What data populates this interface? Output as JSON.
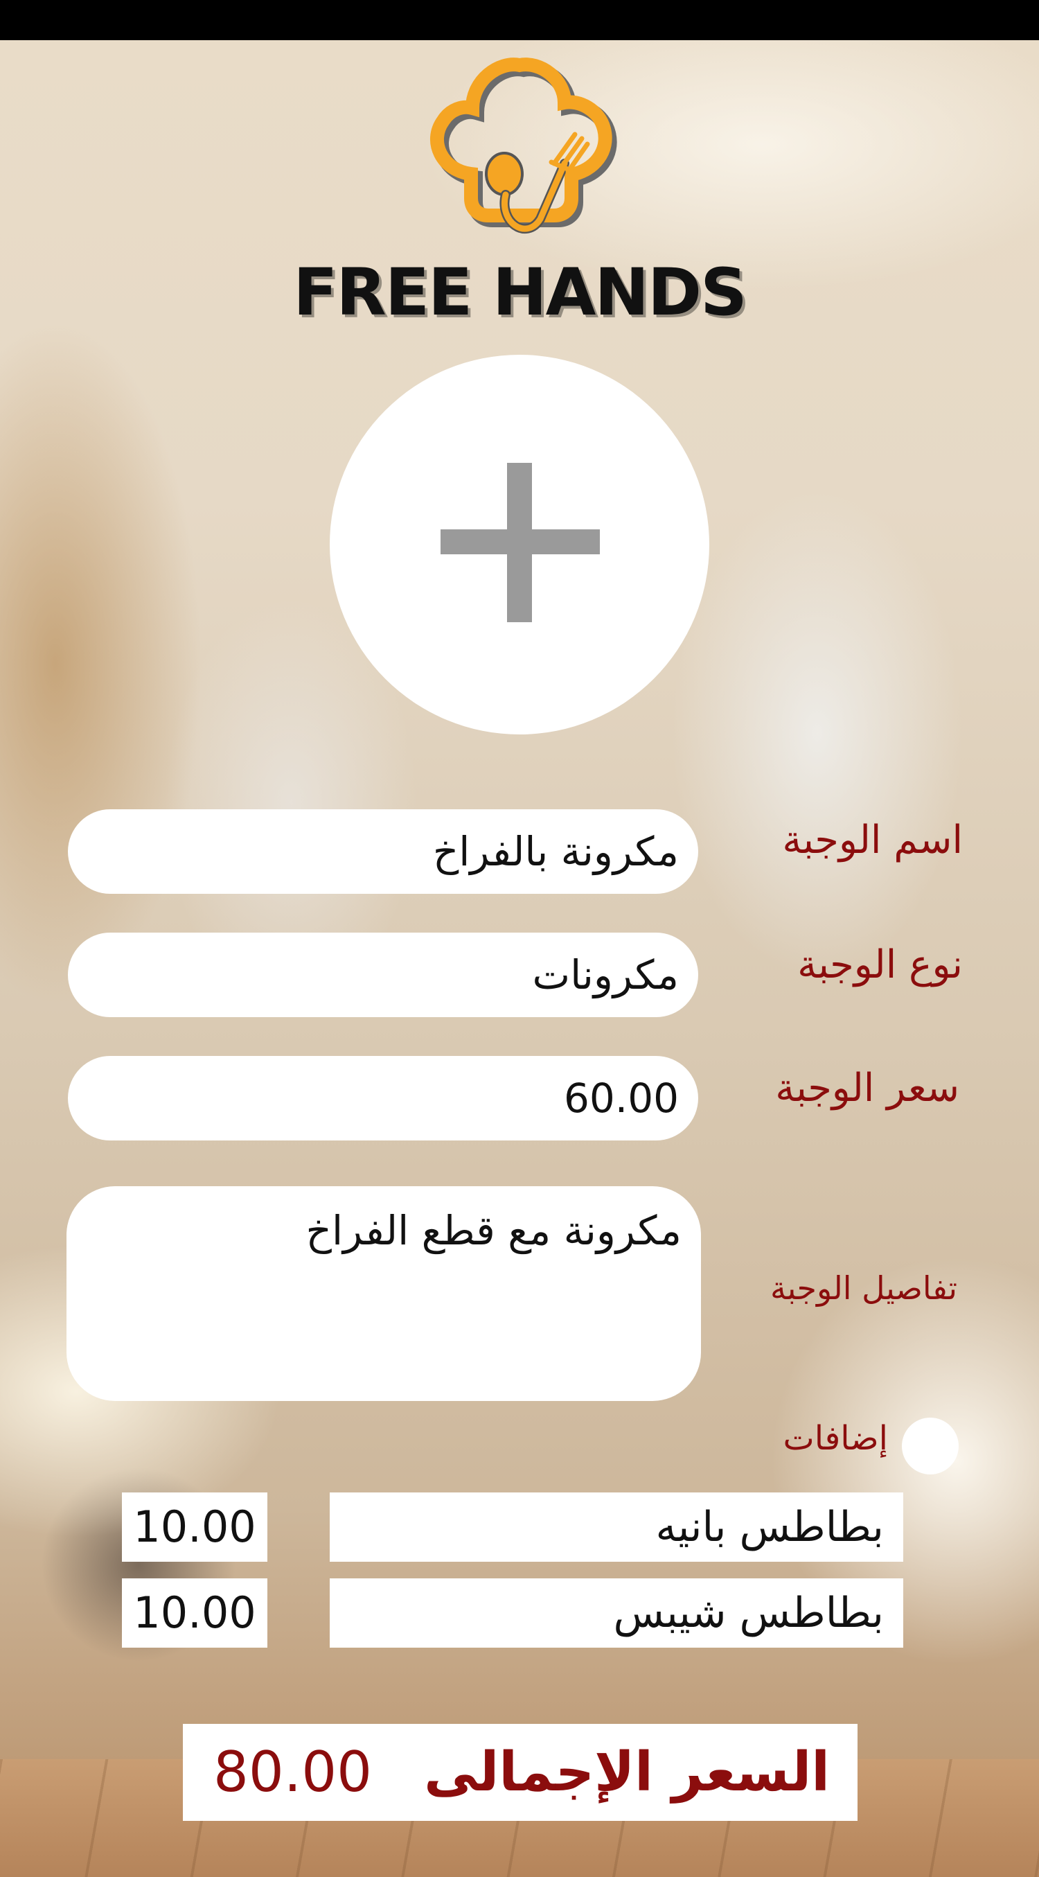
{
  "brand": {
    "name": "FREE HANDS",
    "accent_color": "#f5a523",
    "text_color": "#111111"
  },
  "photo": {
    "icon": "plus-icon"
  },
  "form": {
    "meal_name_label": "اسم الوجبة",
    "meal_name_value": "مكرونة بالفراخ",
    "meal_type_label": "نوع الوجبة",
    "meal_type_value": "مكرونات",
    "meal_price_label": "سعر الوجبة",
    "meal_price_value": "60.00",
    "meal_details_label": "تفاصيل الوجبة",
    "meal_details_value": "مكرونة مع قطع الفراخ"
  },
  "extras": {
    "label": "إضافات",
    "items": [
      {
        "name": "بطاطس بانيه",
        "price": "10.00"
      },
      {
        "name": "بطاطس شيبس",
        "price": "10.00"
      }
    ]
  },
  "total": {
    "label": "السعر الإجمالى",
    "value": "80.00",
    "color": "#8b0d0d"
  }
}
